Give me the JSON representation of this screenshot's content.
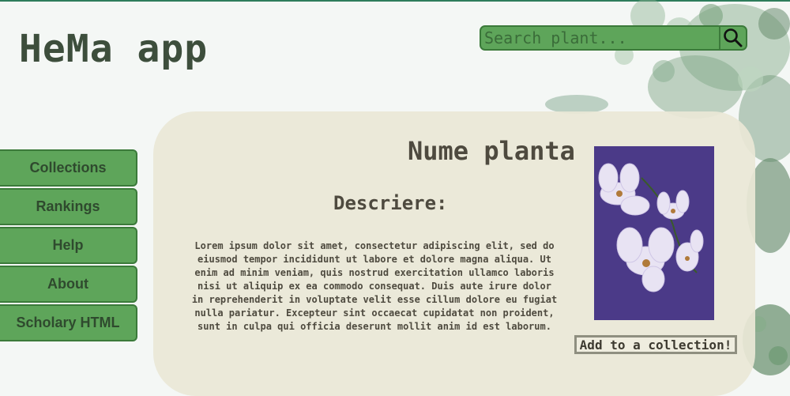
{
  "header": {
    "app_title": "HeMa app",
    "search_placeholder": "Search plant...",
    "search_icon": "magnifier"
  },
  "sidebar": {
    "items": [
      {
        "label": "Collections"
      },
      {
        "label": "Rankings"
      },
      {
        "label": "Help"
      },
      {
        "label": "About"
      },
      {
        "label": "Scholary HTML"
      }
    ]
  },
  "plant": {
    "name": "Nume planta",
    "description_title": "Descriere:",
    "description": "Lorem ipsum dolor sit amet, consectetur adipiscing elit, sed do eiusmod tempor incididunt ut labore et dolore magna aliqua. Ut enim ad minim veniam, quis nostrud exercitation ullamco laboris nisi ut aliquip ex ea commodo consequat. Duis aute irure dolor in reprehenderit in voluptate velit esse cillum dolore eu fugiat nulla pariatur. Excepteur sint occaecat cupidatat non proident, sunt in culpa qui officia deserunt mollit anim id est laborum.",
    "add_button_label": "Add to a collection!"
  },
  "colors": {
    "accent_green": "#5ea55a",
    "border_green": "#3b7a3a",
    "title_text": "#3d4e3c",
    "card_bg": "#eae7d6",
    "image_bg": "#4b3a88"
  }
}
